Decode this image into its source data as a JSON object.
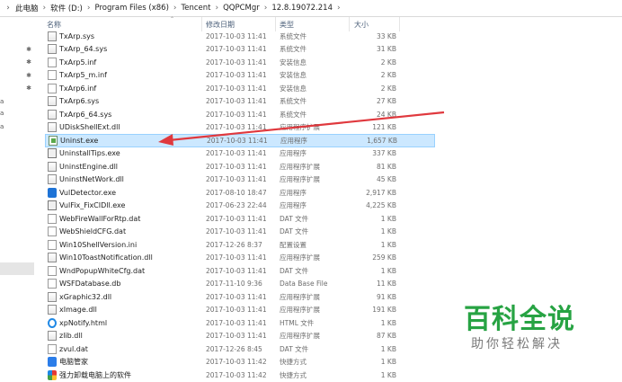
{
  "address_bar": {
    "crumbs": [
      "此电脑",
      "软件 (D:)",
      "Program Files (x86)",
      "Tencent",
      "QQPCMgr",
      "12.8.19072.214"
    ]
  },
  "columns": {
    "name": "名称",
    "date": "修改日期",
    "type": "类型",
    "size": "大小"
  },
  "files": [
    {
      "name": "TxArp.sys",
      "date": "2017-10-03 11:41",
      "type": "系统文件",
      "size": "33 KB",
      "icon": "sys-file-icon",
      "pinned": false
    },
    {
      "name": "TxArp_64.sys",
      "date": "2017-10-03 11:41",
      "type": "系统文件",
      "size": "31 KB",
      "icon": "sys-file-icon",
      "pinned": true
    },
    {
      "name": "TxArp5.inf",
      "date": "2017-10-03 11:41",
      "type": "安装信息",
      "size": "2 KB",
      "icon": "inf-file-icon",
      "pinned": true
    },
    {
      "name": "TxArp5_m.inf",
      "date": "2017-10-03 11:41",
      "type": "安装信息",
      "size": "2 KB",
      "icon": "inf-file-icon",
      "pinned": true
    },
    {
      "name": "TxArp6.inf",
      "date": "2017-10-03 11:41",
      "type": "安装信息",
      "size": "2 KB",
      "icon": "inf-file-icon",
      "pinned": true
    },
    {
      "name": "TxArp6.sys",
      "date": "2017-10-03 11:41",
      "type": "系统文件",
      "size": "27 KB",
      "icon": "sys-file-icon",
      "pinned": false
    },
    {
      "name": "TxArp6_64.sys",
      "date": "2017-10-03 11:41",
      "type": "系统文件",
      "size": "24 KB",
      "icon": "sys-file-icon",
      "pinned": false
    },
    {
      "name": "UDiskShellExt.dll",
      "date": "2017-10-03 11:41",
      "type": "应用程序扩展",
      "size": "121 KB",
      "icon": "dll-file-icon",
      "pinned": false
    },
    {
      "name": "Uninst.exe",
      "date": "2017-10-03 11:41",
      "type": "应用程序",
      "size": "1,657 KB",
      "icon": "uninstaller-icon",
      "pinned": false,
      "selected": true
    },
    {
      "name": "UninstallTips.exe",
      "date": "2017-10-03 11:41",
      "type": "应用程序",
      "size": "337 KB",
      "icon": "exe-window-icon",
      "pinned": false
    },
    {
      "name": "UninstEngine.dll",
      "date": "2017-10-03 11:41",
      "type": "应用程序扩展",
      "size": "81 KB",
      "icon": "dll-file-icon",
      "pinned": false
    },
    {
      "name": "UninstNetWork.dll",
      "date": "2017-10-03 11:41",
      "type": "应用程序扩展",
      "size": "45 KB",
      "icon": "dll-file-icon",
      "pinned": false
    },
    {
      "name": "VulDetector.exe",
      "date": "2017-08-10 18:47",
      "type": "应用程序",
      "size": "2,917 KB",
      "icon": "shield-app-icon",
      "pinned": false
    },
    {
      "name": "VulFix_FixCIDll.exe",
      "date": "2017-06-23 22:44",
      "type": "应用程序",
      "size": "4,225 KB",
      "icon": "exe-window-icon",
      "pinned": false
    },
    {
      "name": "WebFireWallForRtp.dat",
      "date": "2017-10-03 11:41",
      "type": "DAT 文件",
      "size": "1 KB",
      "icon": "dat-file-icon",
      "pinned": false
    },
    {
      "name": "WebShieldCFG.dat",
      "date": "2017-10-03 11:41",
      "type": "DAT 文件",
      "size": "1 KB",
      "icon": "dat-file-icon",
      "pinned": false
    },
    {
      "name": "Win10ShellVersion.ini",
      "date": "2017-12-26 8:37",
      "type": "配置设置",
      "size": "1 KB",
      "icon": "ini-file-icon",
      "pinned": false
    },
    {
      "name": "Win10ToastNotification.dll",
      "date": "2017-10-03 11:41",
      "type": "应用程序扩展",
      "size": "259 KB",
      "icon": "dll-file-icon",
      "pinned": false
    },
    {
      "name": "WndPopupWhiteCfg.dat",
      "date": "2017-10-03 11:41",
      "type": "DAT 文件",
      "size": "1 KB",
      "icon": "dat-file-icon",
      "pinned": false
    },
    {
      "name": "WSFDatabase.db",
      "date": "2017-11-10 9:36",
      "type": "Data Base File",
      "size": "11 KB",
      "icon": "db-file-icon",
      "pinned": false
    },
    {
      "name": "xGraphic32.dll",
      "date": "2017-10-03 11:41",
      "type": "应用程序扩展",
      "size": "91 KB",
      "icon": "dll-file-icon",
      "pinned": false
    },
    {
      "name": "xImage.dll",
      "date": "2017-10-03 11:41",
      "type": "应用程序扩展",
      "size": "191 KB",
      "icon": "dll-file-icon",
      "pinned": false
    },
    {
      "name": "xpNotify.html",
      "date": "2017-10-03 11:41",
      "type": "HTML 文件",
      "size": "1 KB",
      "icon": "html-file-icon",
      "pinned": false
    },
    {
      "name": "zlib.dll",
      "date": "2017-10-03 11:41",
      "type": "应用程序扩展",
      "size": "87 KB",
      "icon": "dll-file-icon",
      "pinned": false
    },
    {
      "name": "zvul.dat",
      "date": "2017-12-26 8:45",
      "type": "DAT 文件",
      "size": "1 KB",
      "icon": "dat-file-icon",
      "pinned": false
    },
    {
      "name": "电脑管家",
      "date": "2017-10-03 11:42",
      "type": "快捷方式",
      "size": "1 KB",
      "icon": "shortcut-icon",
      "pinned": false
    },
    {
      "name": "强力卸载电脑上的软件",
      "date": "2017-10-03 11:42",
      "type": "快捷方式",
      "size": "1 KB",
      "icon": "shortcut-colorful-icon",
      "pinned": false
    }
  ],
  "watermark": {
    "title": "百科全说",
    "subtitle": "助你轻松解决"
  },
  "colors": {
    "selected_row": "#cce8ff",
    "arrow": "#e0393e",
    "watermark": "#27a343"
  }
}
